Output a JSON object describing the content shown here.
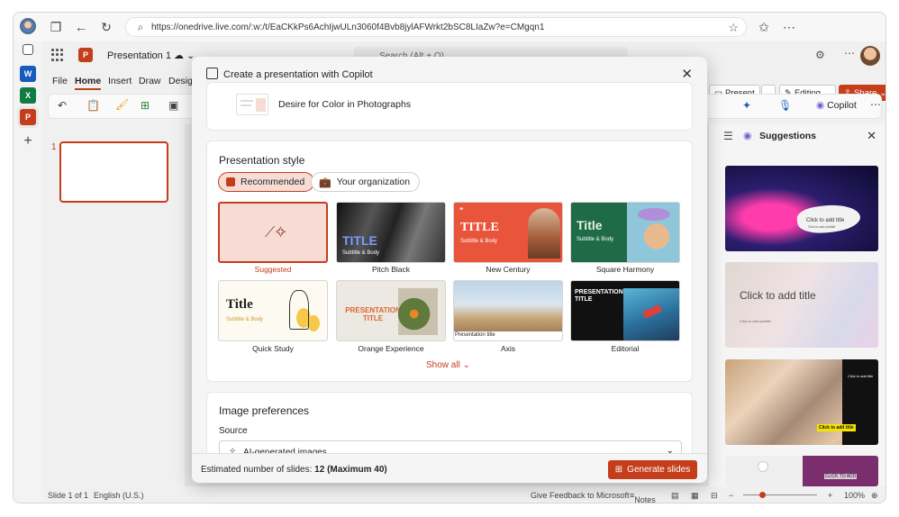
{
  "browser": {
    "url": "https://onedrive.live.com/:w:/t/EaCKkPs6AchIjwULn3060f4Bvb8jylAFWrkt2bSC8LIaZw?e=CMgqn1"
  },
  "office": {
    "doc_title": "Presentation 1",
    "search_placeholder": "Search (Alt + Q)",
    "tabs": [
      "File",
      "Home",
      "Insert",
      "Draw",
      "Desig"
    ],
    "present_label": "Present",
    "editing_label": "Editing",
    "share_label": "Share",
    "copilot_label": "Copilot",
    "slide_number": "1"
  },
  "pane": {
    "title": "Suggestions",
    "s2_title": "Click to add title",
    "s2_sub": "Click to add subtitle",
    "s1_title": "Click to add title",
    "s1_sub": "Click to add subtitle",
    "s3_title": "Click to add title",
    "s3_sub": "Click to add title",
    "s4_title": "CLICK TO ADD"
  },
  "status": {
    "slide": "Slide 1 of 1",
    "lang": "English (U.S.)",
    "feedback": "Give Feedback to Microsoft",
    "notes": "Notes",
    "zoom": "100%"
  },
  "dialog": {
    "title": "Create a presentation with Copilot",
    "prompt_item": "Desire for Color in Photographs",
    "style_heading": "Presentation style",
    "pill_recommended": "Recommended",
    "pill_org": "Your organization",
    "templates": [
      {
        "name": "Suggested",
        "title": ""
      },
      {
        "name": "Pitch Black",
        "title": "TITLE",
        "sub": "Subtitle & Body"
      },
      {
        "name": "New Century",
        "title": "TITLE",
        "sub": "Subtitle & Body"
      },
      {
        "name": "Square Harmony",
        "title": "Title",
        "sub": "Subtitle & Body"
      },
      {
        "name": "Quick Study",
        "title": "Title",
        "sub": "Subtitle & Body"
      },
      {
        "name": "Orange Experience",
        "title": "PRESENTATION TITLE"
      },
      {
        "name": "Axis",
        "title": "Presentation title"
      },
      {
        "name": "Editorial",
        "title": "PRESENTATION TITLE"
      }
    ],
    "show_all": "Show all",
    "image_heading": "Image preferences",
    "source_label": "Source",
    "source_value": "AI-generated images",
    "slides_label": "Estimated number of slides:",
    "slides_value": "12 (Maximum 40)",
    "generate": "Generate slides"
  },
  "colors": {
    "accent": "#c43e1c",
    "accent_light": "#f6dcd4"
  }
}
